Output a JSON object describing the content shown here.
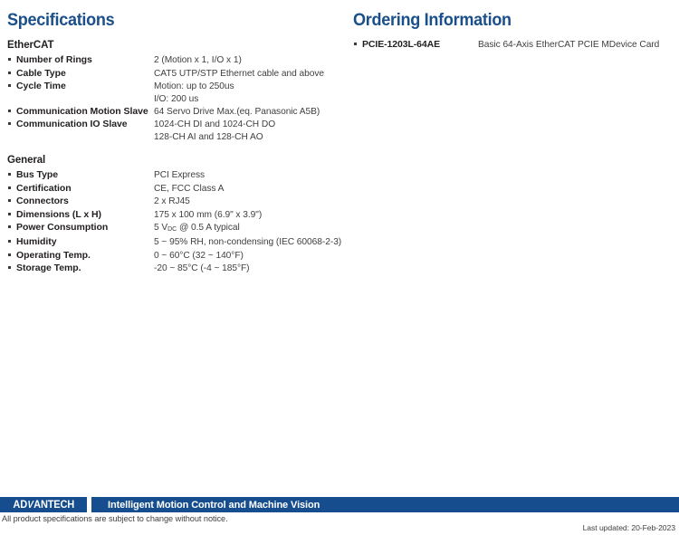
{
  "left_column": {
    "title": "Specifications",
    "groups": [
      {
        "heading": "EtherCAT",
        "rows": [
          {
            "label": "Number of Rings",
            "value": "2 (Motion x 1, I/O x 1)"
          },
          {
            "label": "Cable Type",
            "value": "CAT5 UTP/STP Ethernet cable and above"
          },
          {
            "label": "Cycle Time",
            "value": "Motion: up to 250us\nI/O: 200 us"
          },
          {
            "label": "Communication Motion Slave",
            "value": "64 Servo Drive Max.(eq. Panasonic A5B)"
          },
          {
            "label": "Communication IO Slave",
            "value": "1024-CH DI and 1024-CH DO\n128-CH AI and 128-CH AO"
          }
        ]
      },
      {
        "heading": "General",
        "rows": [
          {
            "label": "Bus Type",
            "value": "PCI Express"
          },
          {
            "label": "Certification",
            "value": "CE, FCC Class A"
          },
          {
            "label": "Connectors",
            "value": "2 x RJ45"
          },
          {
            "label": "Dimensions (L x H)",
            "value": "175 x 100 mm (6.9\" x 3.9\")"
          },
          {
            "label": "Power Consumption",
            "value": "5 VDC @ 0.5 A typical",
            "value_html": "5 V<sub>DC</sub> @ 0.5 A typical"
          },
          {
            "label": "Humidity",
            "value": "5 ~ 95% RH, non-condensing (IEC 60068-2-3)"
          },
          {
            "label": "Operating Temp.",
            "value": "0 ~ 60°C (32 ~ 140°F)"
          },
          {
            "label": "Storage Temp.",
            "value": "-20 ~ 85°C (-4 ~ 185°F)"
          }
        ]
      }
    ]
  },
  "right_column": {
    "title": "Ordering Information",
    "items": [
      {
        "part_number": "PCIE-1203L-64AE",
        "description": "Basic 64-Axis EtherCAT PCIE MDevice Card"
      }
    ]
  },
  "footer": {
    "logo_pre": "AD",
    "logo_vee": "V",
    "logo_post": "ANTECH",
    "logo_full": "ADVANTECH",
    "tagline": "Intelligent Motion Control and Machine Vision",
    "disclaimer": "All product specifications are subject to change without notice.",
    "last_updated": "Last updated: 20-Feb-2023"
  },
  "colors": {
    "heading_blue": "#1a4f8a",
    "footer_blue": "#164d8e",
    "body_text": "#3f3f3f",
    "label_text": "#231f20"
  }
}
